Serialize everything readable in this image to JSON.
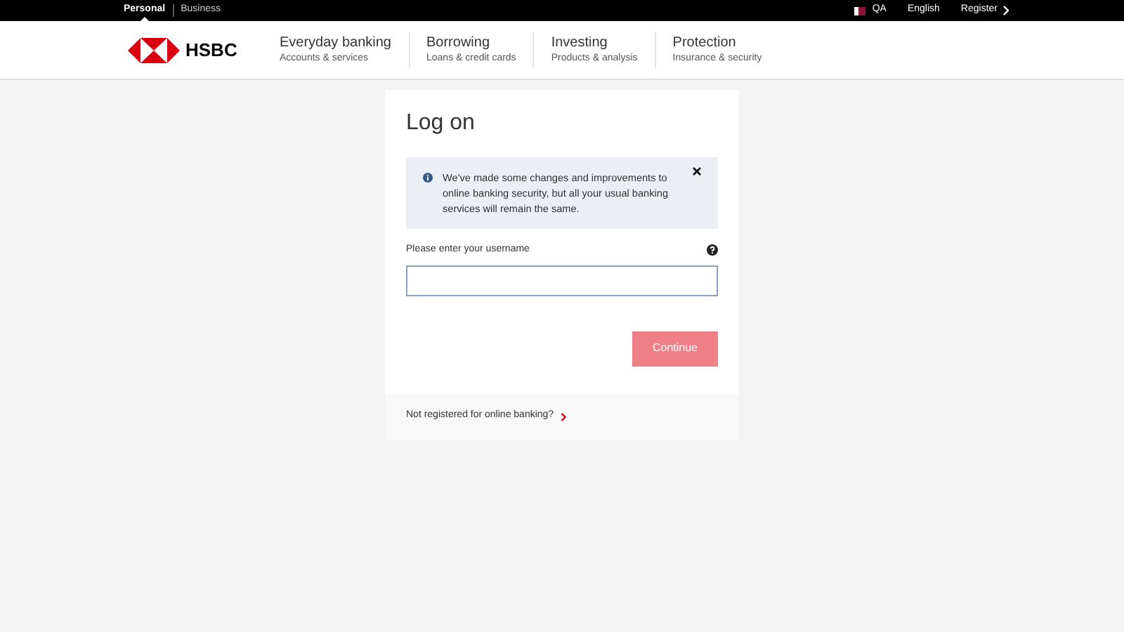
{
  "top_bar": {
    "segments": [
      {
        "label": "Personal",
        "selected": true
      },
      {
        "label": "Business",
        "selected": false
      }
    ],
    "country": "QA",
    "language": "English",
    "register": "Register"
  },
  "header": {
    "logo_text": "HSBC",
    "nav": [
      {
        "title": "Everyday banking",
        "subtitle": "Accounts & services"
      },
      {
        "title": "Borrowing",
        "subtitle": "Loans & credit cards"
      },
      {
        "title": "Investing",
        "subtitle": "Products & analysis"
      },
      {
        "title": "Protection",
        "subtitle": "Insurance & security"
      }
    ]
  },
  "login": {
    "title": "Log on",
    "notice": "We've made some changes and improvements to online banking security, but all your usual banking services will remain the same.",
    "username_label": "Please enter your username",
    "continue": {
      "label": "Continue",
      "disabled": true
    },
    "register_link": "Not registered for online banking?"
  }
}
